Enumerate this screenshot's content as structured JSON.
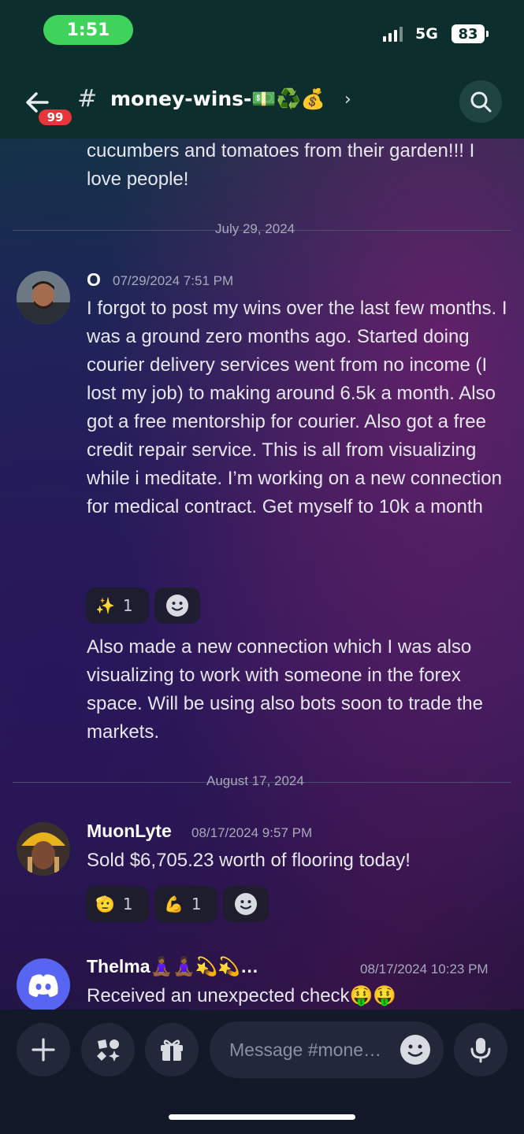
{
  "status": {
    "time": "1:51",
    "network": "5G",
    "battery": "83"
  },
  "header": {
    "back_badge": "99",
    "hash": "#",
    "channel_name": "money-wins-💵♻️💰",
    "chevron": "›"
  },
  "messages": {
    "prev_text": "cucumbers and tomatoes from their garden!!! I love people!",
    "divider1": "July 29, 2024",
    "o_name": "O",
    "o_time": "07/29/2024 7:51 PM",
    "o_text1": "I forgot to post my wins over the last few months. I was a ground zero months ago. Started doing courier delivery services went from no income (I lost my job) to making around 6.5k a month. Also got a free mentorship for courier. Also got a free credit repair service. This is all from visualizing while i meditate. I’m working on a new connection for medical contract. Get myself to 10k a month",
    "o_react_emoji": "✨",
    "o_react_count": "1",
    "o_text2": "Also made a new connection which I was also visualizing to work with someone in the forex space. Will be using also bots soon to trade the markets.",
    "divider2": "August 17, 2024",
    "muon_name": "MuonLyte",
    "muon_time": "08/17/2024 9:57 PM",
    "muon_text": "Sold $6,705.23 worth of flooring today!",
    "muon_react1_emoji": "🫡",
    "muon_react1_count": "1",
    "muon_react2_emoji": "💪",
    "muon_react2_count": "1",
    "thelma_name": "Thelma🧘🏾‍♀️🧘🏾‍♀️💫💫…",
    "thelma_time": "08/17/2024 10:23 PM",
    "thelma_text": "Received an unexpected check🤑🤑"
  },
  "composer": {
    "placeholder": "Message #mone…"
  }
}
